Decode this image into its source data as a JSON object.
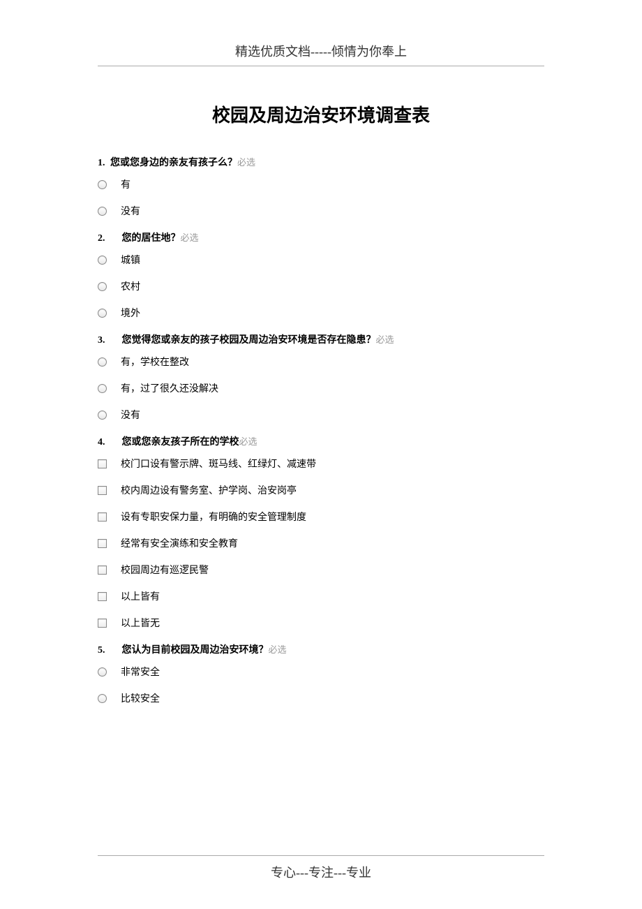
{
  "header": "精选优质文档-----倾情为你奉上",
  "title": "校园及周边治安环境调查表",
  "required_label": "必选",
  "questions": [
    {
      "number": "1.",
      "text": "您或您身边的亲友有孩子么？",
      "type": "radio",
      "inline_num": true,
      "options": [
        "有",
        "没有"
      ]
    },
    {
      "number": "2.",
      "text": "您的居住地？",
      "type": "radio",
      "inline_num": false,
      "options": [
        "城镇",
        "农村",
        "境外"
      ]
    },
    {
      "number": "3.",
      "text": "您觉得您或亲友的孩子校园及周边治安环境是否存在隐患？",
      "type": "radio",
      "inline_num": false,
      "options": [
        "有，学校在整改",
        "有，过了很久还没解决",
        "没有"
      ]
    },
    {
      "number": "4.",
      "text": "您或您亲友孩子所在的学校",
      "type": "checkbox",
      "inline_num": false,
      "options": [
        "校门口设有警示牌、斑马线、红绿灯、减速带",
        "校内周边设有警务室、护学岗、治安岗亭",
        "设有专职安保力量，有明确的安全管理制度",
        "经常有安全演练和安全教育",
        "校园周边有巡逻民警",
        "以上皆有",
        "以上皆无"
      ]
    },
    {
      "number": "5.",
      "text": "您认为目前校园及周边治安环境？",
      "type": "radio",
      "inline_num": false,
      "options": [
        "非常安全",
        "比较安全"
      ]
    }
  ],
  "footer": "专心---专注---专业"
}
